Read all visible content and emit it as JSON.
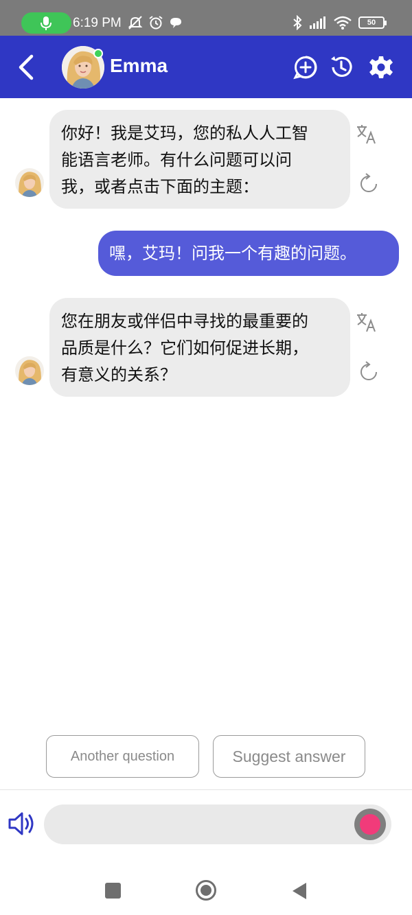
{
  "status_bar": {
    "time": "6:19 PM",
    "battery": "50",
    "icons_left": [
      "mic-icon",
      "mute-icon",
      "alarm-icon",
      "chat-bubble-icon"
    ],
    "icons_right": [
      "bluetooth-icon",
      "signal-icon",
      "wifi-icon",
      "battery-icon"
    ]
  },
  "header": {
    "name": "Emma",
    "status": "online",
    "icons": [
      "back-icon",
      "add-chat-icon",
      "history-icon",
      "settings-icon"
    ]
  },
  "messages": [
    {
      "role": "bot",
      "lines": [
        "你好！我是艾玛，您的私人人工智",
        "能语言老师。有什么问题可以问",
        "我，或者点击下面的主题："
      ]
    },
    {
      "role": "user",
      "lines": [
        "嘿，艾玛！问我一个有趣的问题。"
      ]
    },
    {
      "role": "bot",
      "lines": [
        "您在朋友或伴侣中寻找的最重要的",
        "品质是什么？它们如何促进长期，",
        "有意义的关系？"
      ]
    }
  ],
  "suggestions": {
    "another_question": "Another question",
    "suggest_answer": "Suggest answer"
  },
  "colors": {
    "header": "#2f37c4",
    "user_bubble": "#555bd9",
    "bot_bubble": "#ececec",
    "record": "#f13b7a",
    "online": "#3fd25a"
  }
}
